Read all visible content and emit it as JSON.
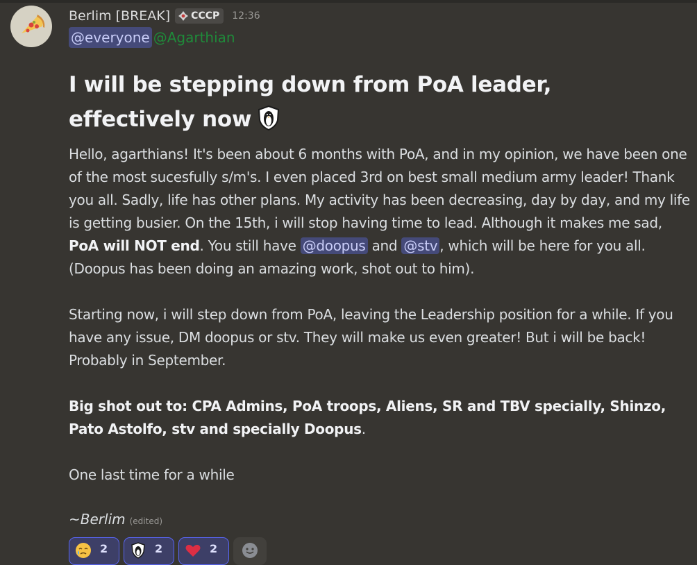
{
  "message": {
    "author": "Berlim [BREAK]",
    "guild_tag": "CCCP",
    "timestamp": "12:36",
    "mentions": {
      "everyone": "@everyone",
      "role": "@Agarthian"
    },
    "title": "I will be stepping down from PoA leader, effectively now",
    "paragraph1": {
      "part1": "Hello, agarthians! It's been about 6 months with PoA, and in my opinion, we have been one of the most sucesfully s/m's. I even placed 3rd on best small medium army leader! Thank you all. Sadly, life has other plans. My activity has been decreasing, day by day, and my life is getting busier. On the 15th, i will stop having time to lead. Although it makes me sad, ",
      "bold": "PoA will NOT end",
      "part2": ". You still have ",
      "mention1": "@doopus",
      "part3": " and ",
      "mention2": "@stv",
      "part4": ", which will be here for you all. (Doopus has been doing an amazing work, shot out to him)."
    },
    "paragraph2": "Starting now, i will step down from PoA, leaving the Leadership position for a while. If you have any issue, DM doopus or stv. They will make us even greater! But i will be back! Probably in September.",
    "paragraph3": {
      "bold": "Big shot out to: CPA Admins, PoA troops, Aliens, SR and TBV specially, Shinzo, Pato Astolfo, stv and specially Doopus",
      "suffix": "."
    },
    "paragraph4": "One last time for a while",
    "signature": "~Berlim",
    "edited": "(edited)",
    "reactions": [
      {
        "emoji": "crying-face",
        "count": "2"
      },
      {
        "emoji": "penguin-shield",
        "count": "2"
      },
      {
        "emoji": "red-heart",
        "count": "2"
      }
    ]
  },
  "colors": {
    "background": "#373531",
    "mention_bg": "#454a79",
    "mention_text": "#c9cdf8",
    "role_mention": "#1f8b3a",
    "reaction_border": "#5865f2"
  }
}
